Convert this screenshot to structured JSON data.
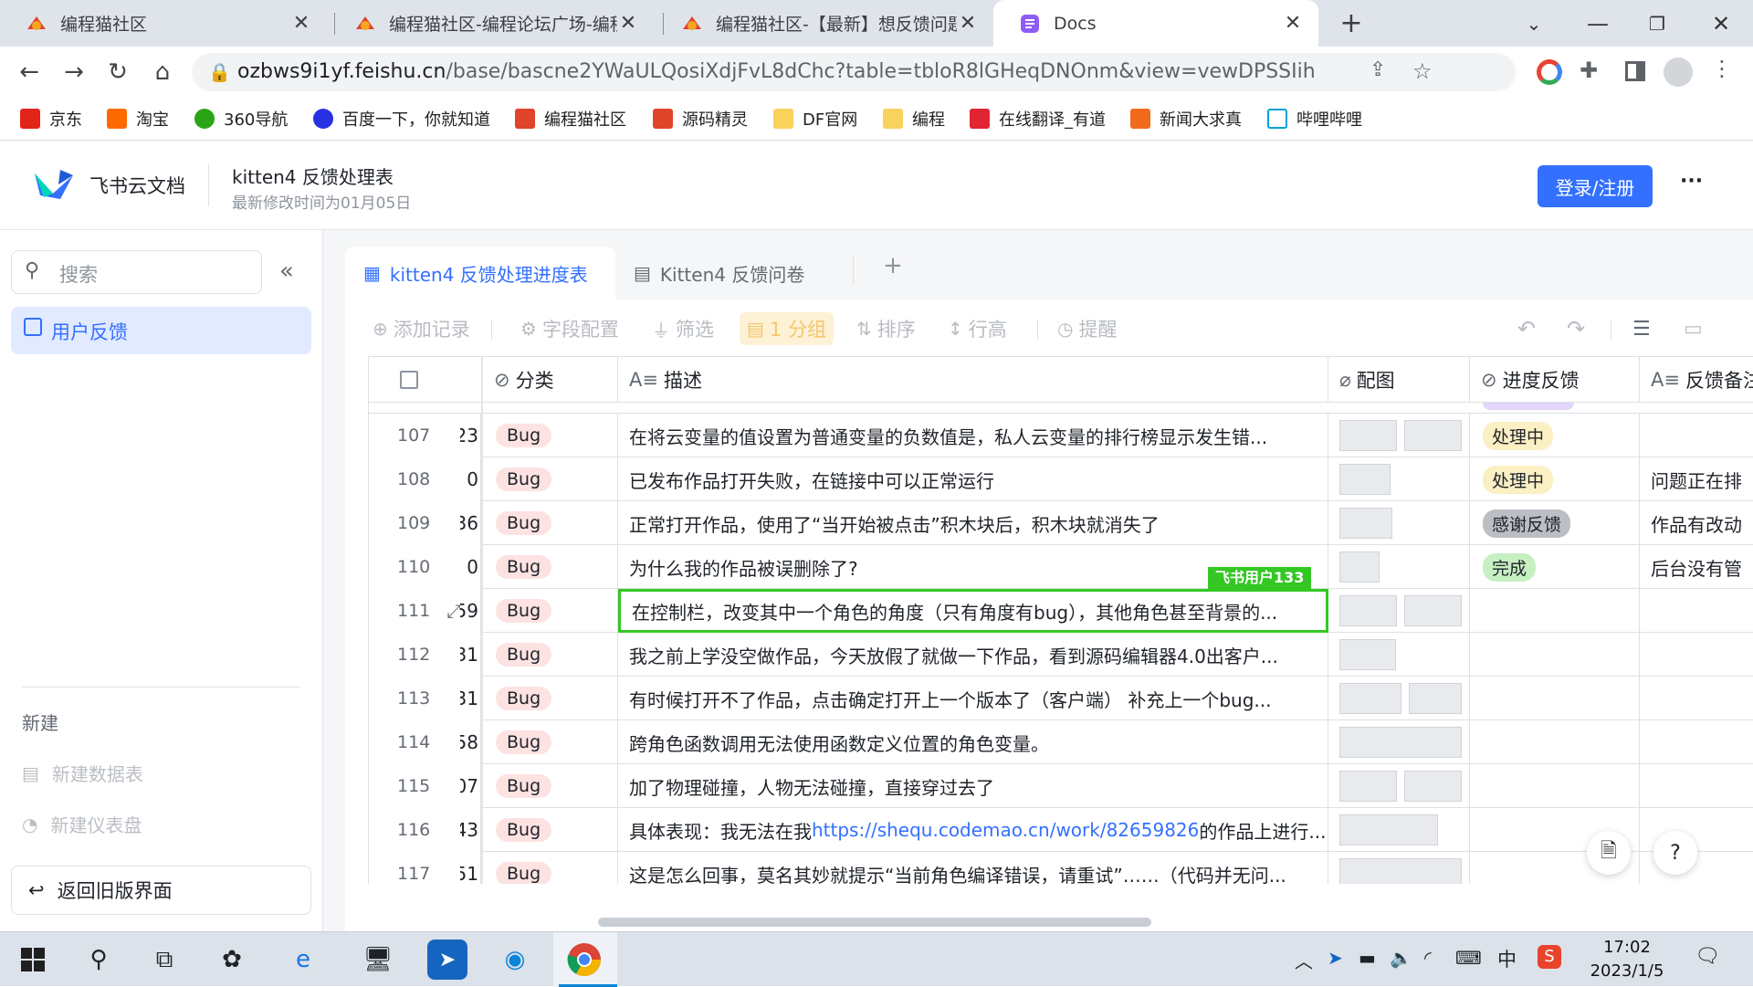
{
  "browser": {
    "tabs": [
      {
        "title": "编程猫社区"
      },
      {
        "title": "编程猫社区-编程论坛广场-编程学"
      },
      {
        "title": "编程猫社区-【最新】想反馈问题"
      },
      {
        "title": "Docs"
      }
    ],
    "new_tab": "+",
    "url_host": "ozbws9i1yf.feishu.cn",
    "url_path": "/base/bascne2YWaULQosiXdjFvL8dChc?table=tbloR8lGHeqDNOnm&view=vewDPSSIih",
    "bookmarks": [
      "京东",
      "淘宝",
      "360导航",
      "百度一下，你就知道",
      "编程猫社区",
      "源码精灵",
      "DF官网",
      "编程",
      "在线翻译_有道",
      "新闻大求真",
      "哔哩哔哩"
    ]
  },
  "header": {
    "brand": "飞书云文档",
    "doc_title": "kitten4 反馈处理表",
    "modified": "最新修改时间为01月05日",
    "login": "登录/注册",
    "more": "···"
  },
  "sidebar": {
    "search_placeholder": "搜索",
    "collapse": "«",
    "item": "用户反馈",
    "new_title": "新建",
    "new_table": "新建数据表",
    "new_dashboard": "新建仪表盘",
    "back": "返回旧版界面"
  },
  "main": {
    "tabs": [
      "kitten4 反馈处理进度表",
      "Kitten4 反馈问卷"
    ],
    "add_tab": "+",
    "toolbar": {
      "add_record": "添加记录",
      "fields": "字段配置",
      "filter": "筛选",
      "group": "1 分组",
      "sort": "排序",
      "row_height": "行高",
      "remind": "提醒"
    },
    "columns": {
      "category": "分类",
      "desc": "描述",
      "image": "配图",
      "progress": "进度反馈",
      "note": "反馈备注"
    },
    "user_tag": "飞书用户133",
    "rows": [
      {
        "no": "107",
        "id": "23",
        "cat": "Bug",
        "desc": "在将云变量的值设置为普通变量的负数值是，私人云变量的排行榜显示发生错...",
        "prog": "处理中",
        "note": ""
      },
      {
        "no": "108",
        "id": "0",
        "cat": "Bug",
        "desc": "已发布作品打开失败，在链接中可以正常运行",
        "prog": "处理中",
        "note": "问题正在排"
      },
      {
        "no": "109",
        "id": "36",
        "cat": "Bug",
        "desc": "正常打开作品，使用了“当开始被点击”积木块后，积木块就消失了",
        "prog": "感谢反馈",
        "note": "作品有改动"
      },
      {
        "no": "110",
        "id": "0",
        "cat": "Bug",
        "desc": "为什么我的作品被误删除了?",
        "prog": "完成",
        "note": "后台没有管"
      },
      {
        "no": "111",
        "id": "59",
        "cat": "Bug",
        "desc": "在控制栏，改变其中一个角色的角度（只有角度有bug），其他角色甚至背景的...",
        "prog": "",
        "note": ""
      },
      {
        "no": "112",
        "id": "31",
        "cat": "Bug",
        "desc": "我之前上学没空做作品，今天放假了就做一下作品，看到源码编辑器4.0出客户...",
        "prog": "",
        "note": ""
      },
      {
        "no": "113",
        "id": "31",
        "cat": "Bug",
        "desc": "有时候打开不了作品，点击确定打开上一个版本了（客户端） 补充上一个bug...",
        "prog": "",
        "note": ""
      },
      {
        "no": "114",
        "id": "58",
        "cat": "Bug",
        "desc": "跨角色函数调用无法使用函数定义位置的角色变量。",
        "prog": "",
        "note": ""
      },
      {
        "no": "115",
        "id": "07",
        "cat": "Bug",
        "desc": "加了物理碰撞，人物无法碰撞，直接穿过去了",
        "prog": "",
        "note": ""
      },
      {
        "no": "116",
        "id": "43",
        "cat": "Bug",
        "desc_pre": "具体表现：我无法在我",
        "desc_link": "https://shequ.codemao.cn/work/82659826",
        "desc_post": "的作品上进行...",
        "prog": "",
        "note": ""
      },
      {
        "no": "117",
        "id": "51",
        "cat": "Bug",
        "desc": "这是怎么回事，莫名其妙就提示“当前角色编译错误，请重试”……（代码并无问...",
        "prog": "",
        "note": ""
      }
    ]
  },
  "taskbar": {
    "time": "17:02",
    "date": "2023/1/5",
    "ime": "中"
  },
  "colors": {
    "accent": "#3370ff",
    "green_border": "#34c724",
    "bug_tag": "#fde2e2",
    "processing": "#fbefc4",
    "thanks": "#bbbfc4",
    "done": "#c7f0c2"
  }
}
